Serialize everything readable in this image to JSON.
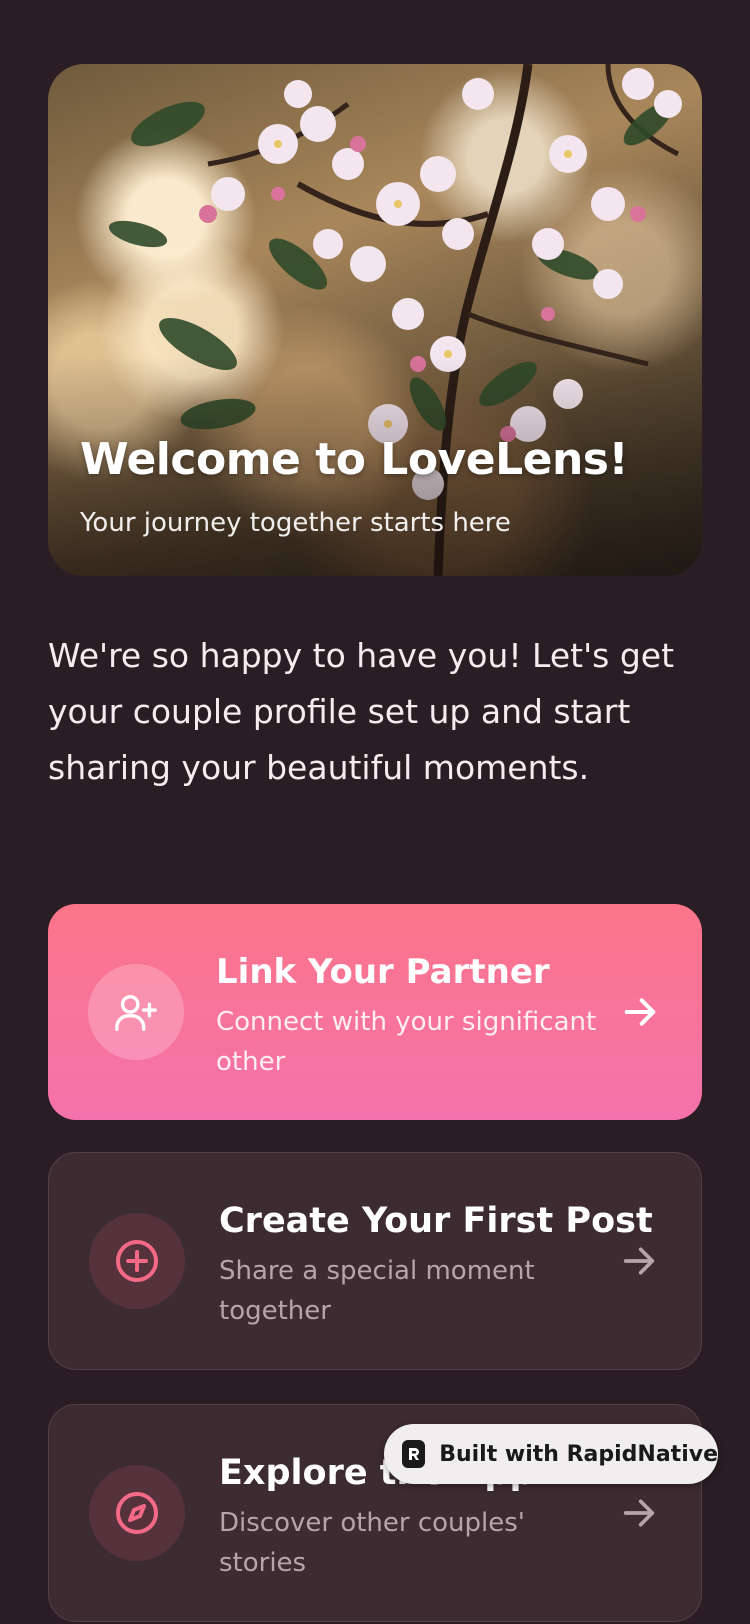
{
  "hero": {
    "title": "Welcome to LoveLens!",
    "subtitle": "Your journey together starts here"
  },
  "intro": "We're so happy to have you! Let's get your couple profile set up and start sharing your beautiful moments.",
  "cards": [
    {
      "title": "Link Your Partner",
      "description": "Connect with your significant other",
      "icon": "user-plus-icon"
    },
    {
      "title": "Create Your First Post",
      "description": "Share a special moment together",
      "icon": "plus-circle-icon"
    },
    {
      "title": "Explore the App",
      "description": "Discover other couples' stories",
      "icon": "compass-icon"
    }
  ],
  "badge": {
    "label": "Built with RapidNative"
  },
  "colors": {
    "background": "#2a1e24",
    "primary_gradient_start": "#fb7589",
    "primary_gradient_end": "#f472ab",
    "secondary_card": "#3c2b31",
    "accent": "#f46a86"
  }
}
